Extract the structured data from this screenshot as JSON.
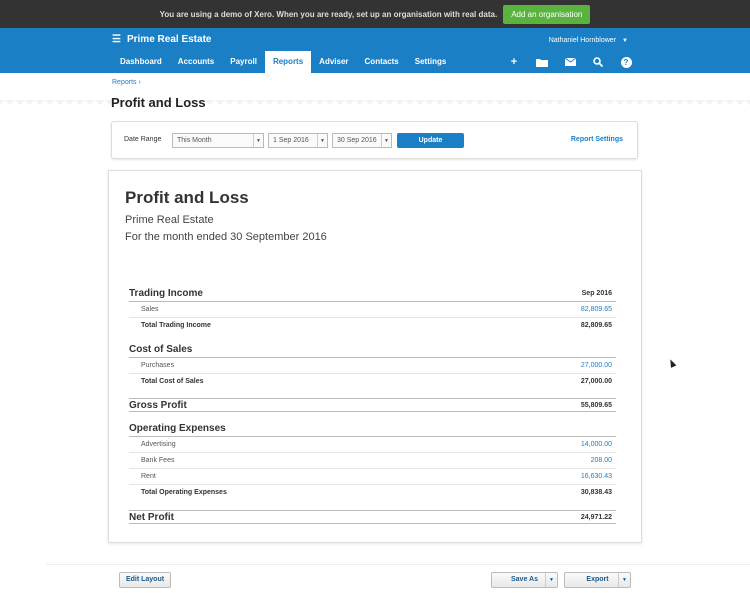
{
  "demo_banner": {
    "message": "You are using a demo of Xero. When you are ready, set up an organisation with real data.",
    "button": "Add an organisation"
  },
  "header": {
    "org_name": "Prime Real Estate",
    "user_name": "Nathaniel Hornblower",
    "nav": [
      "Dashboard",
      "Accounts",
      "Payroll",
      "Reports",
      "Adviser",
      "Contacts",
      "Settings"
    ],
    "active_tab": "Reports",
    "icons": [
      "add-icon",
      "folder-icon",
      "mail-icon",
      "search-icon",
      "help-icon"
    ]
  },
  "breadcrumb": "Reports ›",
  "page_title": "Profit and Loss",
  "filter": {
    "date_range_label": "Date Range",
    "range": "This Month",
    "from": "1 Sep 2016",
    "to": "30 Sep 2016",
    "update": "Update",
    "report_settings": "Report Settings"
  },
  "report": {
    "title": "Profit and Loss",
    "org": "Prime Real Estate",
    "period": "For the month ended 30 September 2016",
    "column": "Sep 2016",
    "trading_income": {
      "heading": "Trading Income",
      "rows": [
        {
          "name": "Sales",
          "amount": "82,809.65"
        }
      ],
      "total_label": "Total Trading Income",
      "total": "82,809.65"
    },
    "cost_of_sales": {
      "heading": "Cost of Sales",
      "rows": [
        {
          "name": "Purchases",
          "amount": "27,000.00"
        }
      ],
      "total_label": "Total Cost of Sales",
      "total": "27,000.00"
    },
    "gross_profit": {
      "label": "Gross Profit",
      "amount": "55,809.65"
    },
    "operating_expenses": {
      "heading": "Operating Expenses",
      "rows": [
        {
          "name": "Advertising",
          "amount": "14,000.00"
        },
        {
          "name": "Bank Fees",
          "amount": "208.00"
        },
        {
          "name": "Rent",
          "amount": "16,630.43"
        }
      ],
      "total_label": "Total Operating Expenses",
      "total": "30,838.43"
    },
    "net_profit": {
      "label": "Net Profit",
      "amount": "24,971.22"
    }
  },
  "footer": {
    "edit_layout": "Edit Layout",
    "save_as": "Save As",
    "export": "Export"
  },
  "colors": {
    "brand": "#1a7fc4",
    "banner_button": "#59b33e"
  }
}
